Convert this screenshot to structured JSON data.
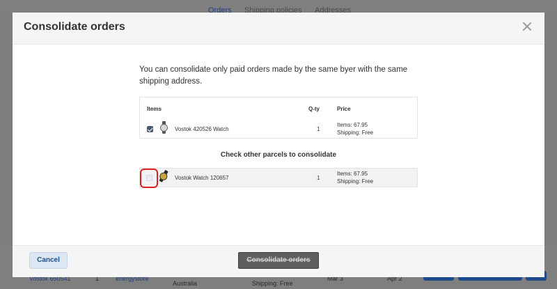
{
  "background": {
    "tabs": [
      {
        "label": "Orders",
        "active": true
      },
      {
        "label": "Shipping policies",
        "active": false
      },
      {
        "label": "Addresses",
        "active": false
      }
    ],
    "row": {
      "item": "Vostok 650541",
      "qty": "1",
      "store": "energystore",
      "country": "Australia",
      "shipping": "Shipping: Free",
      "date1": "Mar 3",
      "date2": "Apr 2"
    }
  },
  "modal": {
    "title": "Consolidate orders",
    "intro": "You can consolidate only paid orders made by the same byer with the same shipping address.",
    "table": {
      "headers": {
        "items": "Items",
        "qty": "Q-ty",
        "price": "Price"
      },
      "rows": [
        {
          "name": "Vostok 420526 Watch",
          "qty": "1",
          "price_items": "Items: 67.95",
          "price_shipping": "Shipping: Free",
          "checked": true
        }
      ]
    },
    "other_title": "Check other parcels to consolidate",
    "other_rows": [
      {
        "name": "Vostok Watch 120657",
        "qty": "1",
        "price_items": "Items: 67.95",
        "price_shipping": "Shipping: Free",
        "checked": false
      }
    ],
    "footer": {
      "cancel_label": "Cancel",
      "consolidate_label": "Consolidate orders"
    }
  },
  "colors": {
    "accent": "#1f4f8a",
    "highlight": "#e02020",
    "overlay": "#7d7d7d"
  }
}
